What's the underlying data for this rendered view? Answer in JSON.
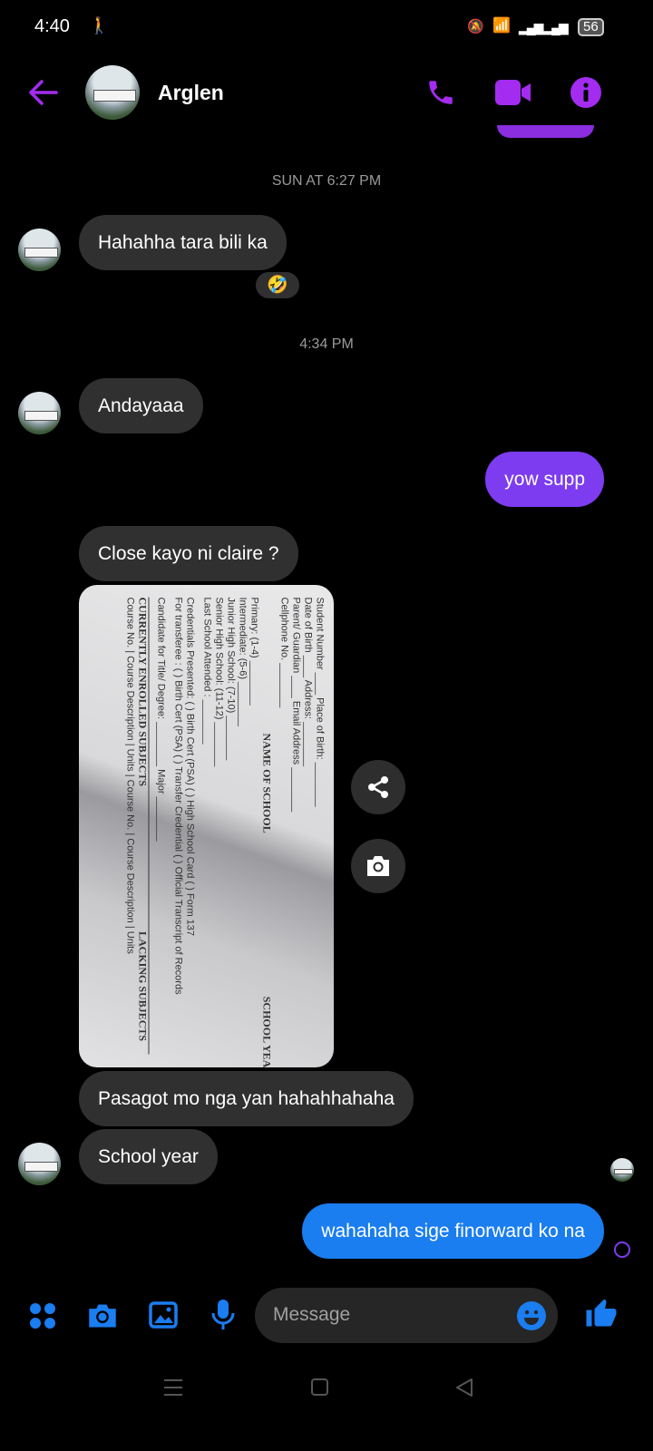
{
  "status_bar": {
    "time": "4:40",
    "battery": "56"
  },
  "header": {
    "contact_name": "Arglen"
  },
  "messages": {
    "ts1": "SUN AT 6:27 PM",
    "m1": "Hahahha tara bili ka",
    "m1_reaction": "🤣",
    "ts2": "4:34 PM",
    "m2": "Andayaaa",
    "m3": "yow supp",
    "m4": "Close kayo ni claire ?",
    "m6": "Pasagot mo nga yan hahahhahaha",
    "m7": "School year",
    "m8": "wahahaha sige finorward ko na"
  },
  "photo_doc": {
    "l1": "Student Number ____ Place of Birth: ________",
    "l2": "Date of Birth ____ Address: ________",
    "l3": "Parent/ Guardian ____ Email Address ________",
    "l4": "Cellphone No. ________",
    "h1": "NAME OF SCHOOL",
    "h2": "SCHOOL YEAR",
    "l5": "Primary: (1-4) ________",
    "l6": "Intermediate: (5-6) ________",
    "l7": "Junior High School: (7-10) ________",
    "l8": "Senior High School: (11-12) ________",
    "l9": "Last School Attended : ________",
    "l10": "Credentials Presented: ( ) Birth Cert (PSA) ( ) High School Card ( ) Form 137",
    "l11": "For transferee :      ( ) Birth Cert (PSA) ( ) Transfer Credential ( ) Official Transcript of Records",
    "l12": "Candidate for Title/ Degree: ________ Major ________",
    "h3": "CURRENTLY ENROLLED SUBJECTS",
    "h4": "LACKING SUBJECTS",
    "l13": "Course No. | Course Description | Units | Course No. | Course Description | Units"
  },
  "composer": {
    "placeholder": "Message"
  }
}
